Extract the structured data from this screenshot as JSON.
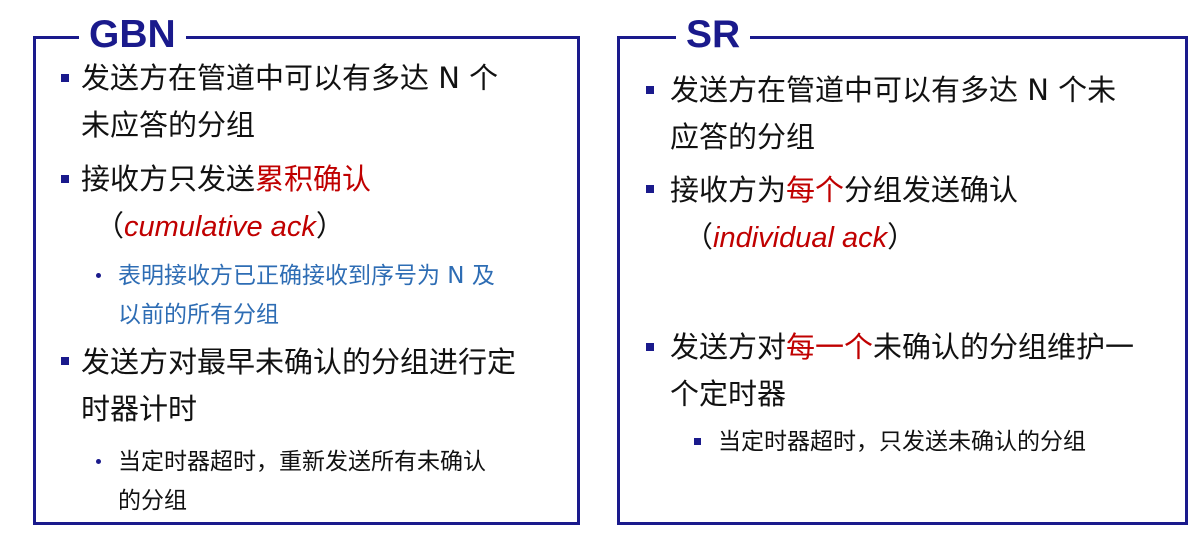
{
  "gbn": {
    "title": "GBN",
    "item1": {
      "line1": "发送方在管道中可以有多达 N 个",
      "line2": "未应答的分组"
    },
    "item2": {
      "prefix": "接收方只发送",
      "highlight": "累积确认",
      "paren_open": "（",
      "english": "cumulative ack",
      "paren_close": "）"
    },
    "sub2": {
      "line1": "表明接收方已正确接收到序号为 N 及",
      "line2": "以前的所有分组"
    },
    "item3": {
      "line1": "发送方对最早未确认的分组进行定",
      "line2": "时器计时"
    },
    "sub3": {
      "line1": "当定时器超时，重新发送所有未确认",
      "line2": "的分组"
    }
  },
  "sr": {
    "title": "SR",
    "item1": {
      "line1": "发送方在管道中可以有多达 N 个未",
      "line2": "应答的分组"
    },
    "item2": {
      "prefix": "接收方为",
      "highlight": "每个",
      "suffix": "分组发送确认",
      "paren_open": "（",
      "english": "individual ack",
      "paren_close": "）"
    },
    "item3": {
      "prefix": "发送方对",
      "highlight": "每一个",
      "suffix": "未确认的分组维护一",
      "line2": "个定时器"
    },
    "sub3": {
      "line1": "当定时器超时，只发送未确认的分组"
    }
  },
  "colors": {
    "border": "#1a1a8c",
    "title": "#1a1a8c",
    "highlight": "#c00000",
    "sub_blue": "#2e6db4",
    "text": "#111111"
  }
}
